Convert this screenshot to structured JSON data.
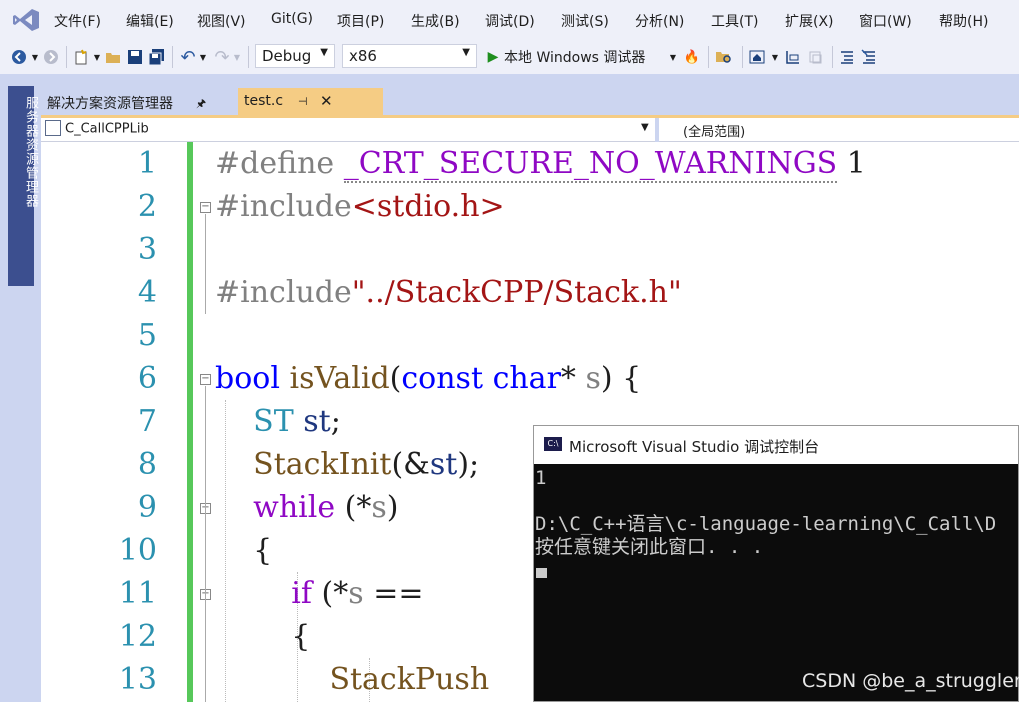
{
  "menubar": {
    "logo_icon": "visual-studio-logo-icon",
    "items": [
      "文件(F)",
      "编辑(E)",
      "视图(V)",
      "Git(G)",
      "项目(P)",
      "生成(B)",
      "调试(D)",
      "测试(S)",
      "分析(N)",
      "工具(T)",
      "扩展(X)",
      "窗口(W)",
      "帮助(H)"
    ]
  },
  "toolbar": {
    "config": "Debug",
    "platform": "x86",
    "run_label": "本地 Windows 调试器"
  },
  "sidestrip": {
    "label": "服务器资源管理器"
  },
  "tabs": {
    "solution_explorer": "解决方案资源管理器",
    "active_file": "test.c"
  },
  "navbar": {
    "project": "C_CallCPPLib",
    "scope": "(全局范围)"
  },
  "editor": {
    "line_numbers": [
      "1",
      "2",
      "3",
      "4",
      "5",
      "6",
      "7",
      "8",
      "9",
      "10",
      "11",
      "12",
      "13"
    ]
  },
  "console": {
    "title": "Microsoft Visual Studio 调试控制台",
    "lines": [
      "1",
      "",
      "D:\\C_C++语言\\c-language-learning\\C_Call\\D",
      "按任意键关闭此窗口. . ."
    ]
  },
  "watermark": "CSDN @be_a_struggler",
  "colors": {
    "accent_tab": "#f5cc84",
    "change_bar": "#57c85a",
    "line_number": "#2b91af",
    "keyword_purple": "#8f08c4",
    "keyword_blue": "#0000ff",
    "string": "#a31515"
  }
}
